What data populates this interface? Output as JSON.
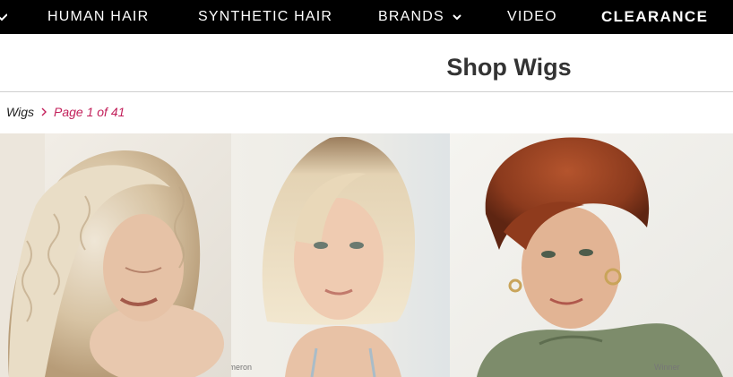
{
  "nav": {
    "items": [
      {
        "label": "HUMAN HAIR"
      },
      {
        "label": "SYNTHETIC HAIR"
      },
      {
        "label": "BRANDS"
      },
      {
        "label": "VIDEO"
      },
      {
        "label": "CLEARANCE"
      }
    ]
  },
  "page": {
    "title": "Shop Wigs"
  },
  "breadcrumb": {
    "link": "Wigs",
    "current": "Page 1 of 41"
  },
  "products": [
    {
      "caption": ""
    },
    {
      "caption": "Cameron"
    },
    {
      "caption": "Winner"
    }
  ],
  "colors": {
    "nav_bg": "#000000",
    "accent": "#c21f5a"
  }
}
